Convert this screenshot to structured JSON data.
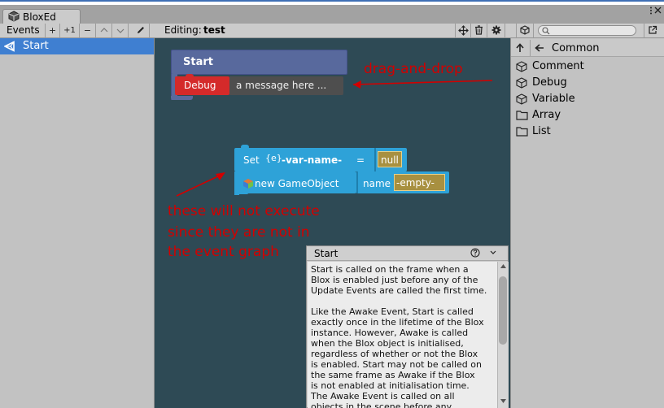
{
  "window": {
    "tab_title": "BloxEd",
    "menu_glyph": "⋮≡",
    "close_glyph": "✕"
  },
  "toolbar": {
    "events_label": "Events",
    "add_label": "+",
    "add_one_label": "+1",
    "remove_label": "−",
    "up_label": "⌃",
    "down_label": "⌄",
    "editing_label": "Editing:",
    "editing_name": "test",
    "search_value": ""
  },
  "events_list": {
    "items": [
      {
        "label": "Start",
        "selected": true
      }
    ]
  },
  "canvas": {
    "event_block": {
      "title": "Start"
    },
    "debug_block": {
      "label": "Debug",
      "value": "a message here ..."
    },
    "set_block": {
      "prefix": "Set",
      "var_tag": "{e}",
      "var_name": "-var-name-",
      "equals": "=",
      "value": "null"
    },
    "new_block": {
      "label": "new GameObject",
      "param_label": "name",
      "param_value": "-empty-"
    },
    "annotations": {
      "drag_drop": "drag-and-drop",
      "note_line1": "these will not execute",
      "note_line2": "since they are not in",
      "note_line3": "the event graph"
    },
    "colors": {
      "background": "#2e4a55",
      "event_block": "#58699d",
      "debug_block": "#d42a2a",
      "variable_block": "#2ea2d8",
      "value_field": "#a89040",
      "annotation": "#d20000"
    }
  },
  "library": {
    "back_label": "←",
    "category": "Common",
    "items": [
      {
        "label": "Comment",
        "icon": "cube-icon"
      },
      {
        "label": "Debug",
        "icon": "cube-icon"
      },
      {
        "label": "Variable",
        "icon": "cube-icon"
      },
      {
        "label": "Array",
        "icon": "folder-icon"
      },
      {
        "label": "List",
        "icon": "folder-icon"
      }
    ]
  },
  "help": {
    "title": "Start",
    "lines": [
      "Start is called on the frame when a",
      "Blox is enabled just before any of the",
      "Update Events are called the first time.",
      "",
      "Like the Awake Event, Start is called",
      "exactly once in the lifetime of the Blox",
      "instance. However, Awake is called",
      "when the Blox object is initialised,",
      "regardless of whether or not the Blox",
      "is enabled. Start may not be called on",
      "the same frame as Awake if the Blox",
      "is not enabled at initialisation time.",
      "The Awake Event is called on all",
      "objects in the scene before any"
    ]
  }
}
